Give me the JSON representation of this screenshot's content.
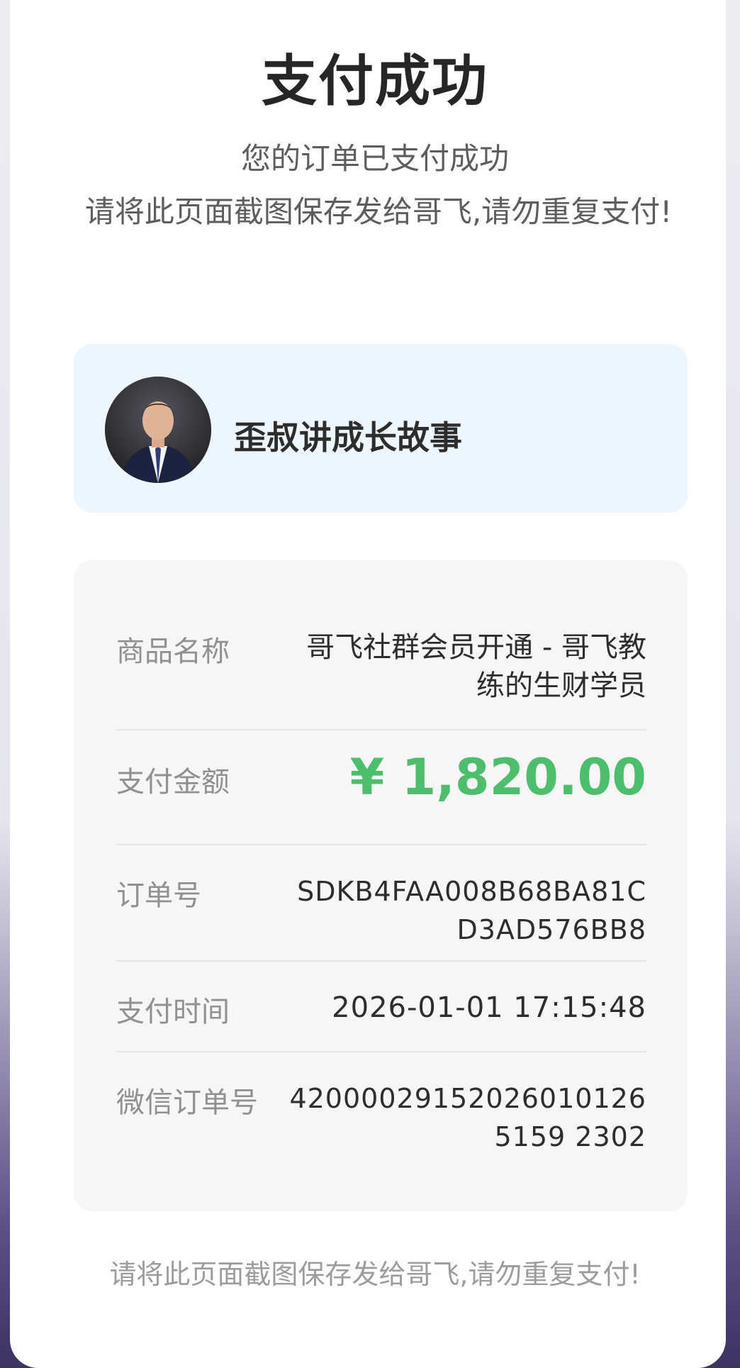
{
  "header": {
    "title": "支付成功",
    "subtitle": "您的订单已支付成功",
    "notice": "请将此页面截图保存发给哥飞,请勿重复支付!"
  },
  "merchant": {
    "name": "歪叔讲成长故事",
    "avatar_icon": "person-avatar"
  },
  "details": {
    "product_label": "商品名称",
    "product_value": "哥飞社群会员开通 - 哥飞教练的生财学员",
    "amount_label": "支付金额",
    "amount_value": "¥ 1,820.00",
    "order_label": "订单号",
    "order_value": "SDKB4FAA008B68BA81CD3AD576BB8",
    "time_label": "支付时间",
    "time_value": "2026-01-01 17:15:48",
    "wechat_label": "微信订单号",
    "wechat_value": "420000291520260101265159 2302"
  },
  "footer": {
    "notice": "请将此页面截图保存发给哥飞,请勿重复支付!"
  },
  "colors": {
    "amount": "#4dbe6c",
    "merchant_bg": "#eef6fd",
    "details_bg": "#f6f6f7"
  }
}
